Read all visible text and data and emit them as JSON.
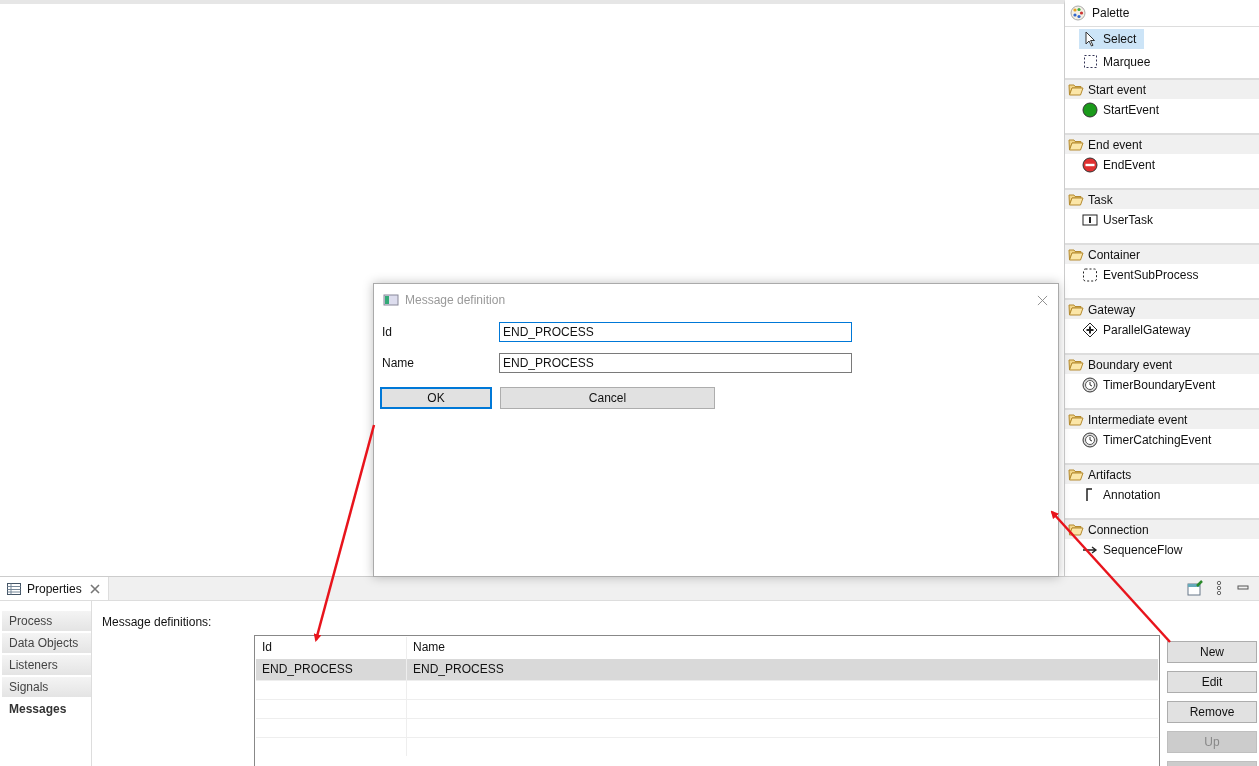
{
  "palette": {
    "title": "Palette",
    "tools": [
      {
        "label": "Select",
        "kind": "select",
        "selected": true
      },
      {
        "label": "Marquee",
        "kind": "marquee",
        "selected": false
      }
    ],
    "drawers": [
      {
        "title": "Start event",
        "items": [
          {
            "label": "StartEvent",
            "kind": "start"
          }
        ]
      },
      {
        "title": "End event",
        "items": [
          {
            "label": "EndEvent",
            "kind": "end"
          }
        ]
      },
      {
        "title": "Task",
        "items": [
          {
            "label": "UserTask",
            "kind": "usertask"
          }
        ]
      },
      {
        "title": "Container",
        "items": [
          {
            "label": "EventSubProcess",
            "kind": "subprocess"
          }
        ]
      },
      {
        "title": "Gateway",
        "items": [
          {
            "label": "ParallelGateway",
            "kind": "gateway"
          }
        ]
      },
      {
        "title": "Boundary event",
        "items": [
          {
            "label": "TimerBoundaryEvent",
            "kind": "timer"
          }
        ]
      },
      {
        "title": "Intermediate event",
        "items": [
          {
            "label": "TimerCatchingEvent",
            "kind": "timer"
          }
        ]
      },
      {
        "title": "Artifacts",
        "items": [
          {
            "label": "Annotation",
            "kind": "annotation"
          }
        ]
      },
      {
        "title": "Connection",
        "items": [
          {
            "label": "SequenceFlow",
            "kind": "flow"
          }
        ]
      }
    ]
  },
  "properties": {
    "tab": "Properties",
    "sections": [
      {
        "label": "Process",
        "selected": false
      },
      {
        "label": "Data Objects",
        "selected": false
      },
      {
        "label": "Listeners",
        "selected": false
      },
      {
        "label": "Signals",
        "selected": false
      },
      {
        "label": "Messages",
        "selected": true
      }
    ],
    "heading": "Message definitions:",
    "table": {
      "columns": [
        "Id",
        "Name"
      ],
      "rows": [
        {
          "cells": [
            "END_PROCESS",
            "END_PROCESS"
          ],
          "selected": true
        }
      ]
    },
    "buttons": [
      {
        "label": "New",
        "disabled": false
      },
      {
        "label": "Edit",
        "disabled": false
      },
      {
        "label": "Remove",
        "disabled": false
      },
      {
        "label": "Up",
        "disabled": true
      }
    ]
  },
  "dialog": {
    "title": "Message definition",
    "fields": [
      {
        "label": "Id",
        "value": "END_PROCESS",
        "focused": true
      },
      {
        "label": "Name",
        "value": "END_PROCESS",
        "focused": false
      }
    ],
    "buttons": [
      {
        "label": "OK",
        "default": true
      },
      {
        "label": "Cancel",
        "default": false
      }
    ]
  }
}
